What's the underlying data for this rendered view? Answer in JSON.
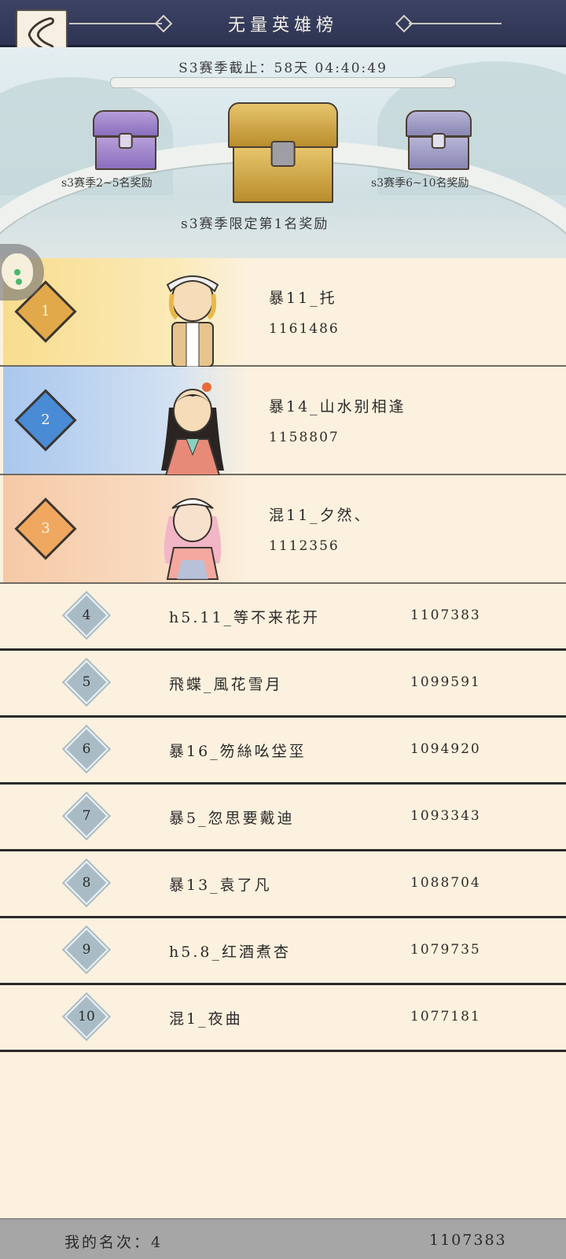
{
  "header": {
    "title": "无量英雄榜",
    "back_icon": "back-arrow-icon"
  },
  "banner": {
    "season_countdown": "S3赛季截止：58天 04:40:49",
    "reward_left": "s3赛季2~5名奖励",
    "reward_right": "s3赛季6~10名奖励",
    "reward_center": "s3赛季限定第1名奖励"
  },
  "top_ranks": [
    {
      "rank": "1",
      "name": "暴11_托",
      "score": "1161486"
    },
    {
      "rank": "2",
      "name": "暴14_山水别相逢",
      "score": "1158807"
    },
    {
      "rank": "3",
      "name": "混11_夕然、",
      "score": "1112356"
    }
  ],
  "ranks": [
    {
      "rank": "4",
      "name": "h5.11_等不来花开",
      "score": "1107383"
    },
    {
      "rank": "5",
      "name": "飛蝶_風花雪月",
      "score": "1099591"
    },
    {
      "rank": "6",
      "name": "暴16_笏絲吆垈坙",
      "score": "1094920"
    },
    {
      "rank": "7",
      "name": "暴5_忽思要戴迪",
      "score": "1093343"
    },
    {
      "rank": "8",
      "name": "暴13_袁了凡",
      "score": "1088704"
    },
    {
      "rank": "9",
      "name": "h5.8_红酒煮杏",
      "score": "1079735"
    },
    {
      "rank": "10",
      "name": "混1_夜曲",
      "score": "1077181"
    }
  ],
  "footer": {
    "my_rank": "我的名次：4",
    "my_score": "1107383"
  },
  "colors": {
    "topbar": "#2e3452",
    "list_bg": "#fbf1de",
    "gold": "#e2a94a",
    "blue": "#4a8bd6",
    "bronze": "#f0a860",
    "badge": "#a9bcc6",
    "footer": "#a6a6a6"
  }
}
